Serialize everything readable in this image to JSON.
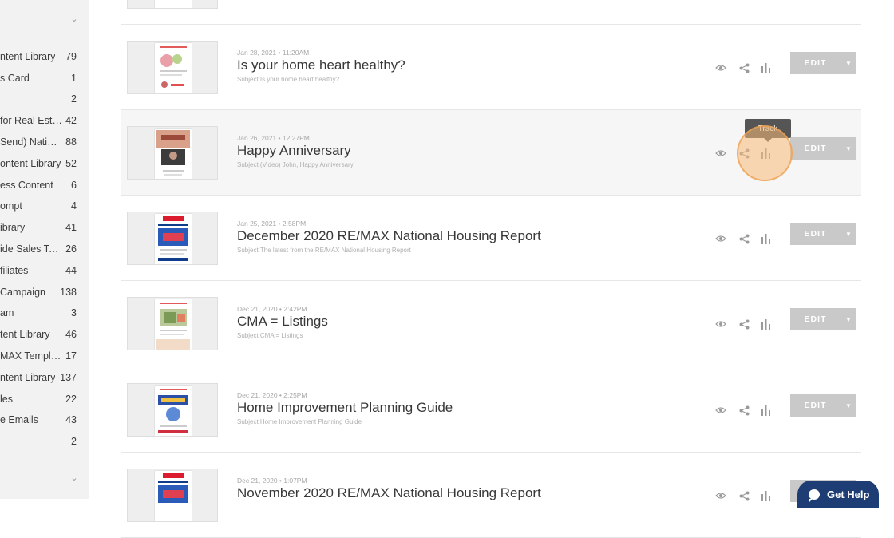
{
  "sidebar": {
    "items": [
      {
        "label": "ntent Library",
        "count": "79"
      },
      {
        "label": "s Card",
        "count": "1"
      },
      {
        "label": "",
        "count": "2"
      },
      {
        "label": "for Real Estate",
        "count": "42"
      },
      {
        "label": "Send) Natio…",
        "count": "88"
      },
      {
        "label": "ontent Library",
        "count": "52"
      },
      {
        "label": "ess Content",
        "count": "6"
      },
      {
        "label": "ompt",
        "count": "4"
      },
      {
        "label": "ibrary",
        "count": "41"
      },
      {
        "label": "ide Sales Team",
        "count": "26"
      },
      {
        "label": "filiates",
        "count": "44"
      },
      {
        "label": " Campaign",
        "count": "138"
      },
      {
        "label": "am",
        "count": "3"
      },
      {
        "label": "tent Library",
        "count": "46"
      },
      {
        "label": "MAX Templa…",
        "count": "17"
      },
      {
        "label": "ntent Library",
        "count": "137"
      },
      {
        "label": "les",
        "count": "22"
      },
      {
        "label": "e Emails",
        "count": "43"
      },
      {
        "label": "",
        "count": "2"
      }
    ]
  },
  "emails": [
    {
      "date": "Jan 28, 2021  •  11:20AM",
      "title": "Is your home heart healthy?",
      "subject": "Subject:Is your home heart healthy?",
      "edit": "EDIT"
    },
    {
      "date": "Jan 26, 2021  •  12:27PM",
      "title": "Happy Anniversary",
      "subject": "Subject:(Video) John, Happy Anniversary",
      "edit": "EDIT"
    },
    {
      "date": "Jan 25, 2021  •  2:58PM",
      "title": "December 2020 RE/MAX National Housing Report",
      "subject": "Subject:The latest from the RE/MAX National Housing Report",
      "edit": "EDIT"
    },
    {
      "date": "Dec 21, 2020  •  2:42PM",
      "title": "CMA = Listings",
      "subject": "Subject:CMA = Listings",
      "edit": "EDIT"
    },
    {
      "date": "Dec 21, 2020  •  2:25PM",
      "title": "Home Improvement Planning Guide",
      "subject": "Subject:Home Improvement Planning Guide",
      "edit": "EDIT"
    },
    {
      "date": "Dec 21, 2020  •  1:07PM",
      "title": "November 2020 RE/MAX National Housing Report",
      "subject": "",
      "edit": "EDIT"
    }
  ],
  "tooltip": "Track",
  "help": {
    "label": "Get Help"
  },
  "colors": {
    "help_bg": "#1e3d74",
    "edit_bg": "#c9c9c9",
    "highlight_ring": "#f4b070"
  }
}
